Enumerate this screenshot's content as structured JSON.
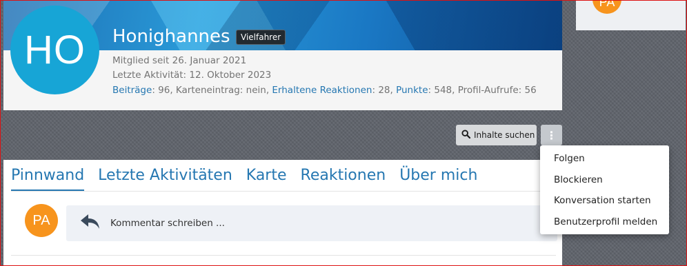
{
  "profile": {
    "avatar_initials": "HO",
    "name": "Honighannes",
    "role_badge": "Vielfahrer",
    "member_since": "Mitglied seit 26. Januar 2021",
    "last_activity": "Letzte Aktivität: 12. Oktober 2023",
    "stats": {
      "posts_label": "Beiträge",
      "posts_value": ": 96, Karteneintrag: nein, ",
      "reactions_label": "Erhaltene Reaktionen",
      "reactions_value": ": 28, ",
      "points_label": "Punkte",
      "points_value": ": 548, Profil-Aufrufe: 56"
    }
  },
  "sidebar": {
    "avatar_initials": "PA"
  },
  "actions": {
    "search_content_label": "Inhalte suchen",
    "more_label": "⋮"
  },
  "dropdown": {
    "items": [
      "Folgen",
      "Blockieren",
      "Konversation starten",
      "Benutzerprofil melden"
    ]
  },
  "tabs": [
    "Pinnwand",
    "Letzte Aktivitäten",
    "Karte",
    "Reaktionen",
    "Über mich"
  ],
  "wall": {
    "avatar_initials": "PA",
    "comment_placeholder": "Kommentar schreiben ..."
  },
  "colors": {
    "link": "#2577b1",
    "avatar_profile": "#17a5d6",
    "avatar_visitor": "#f7941d",
    "badge_bg": "#222a30"
  },
  "icons": {
    "search": "search-icon",
    "more": "vertical-dots-icon",
    "reply": "reply-arrow-icon"
  }
}
